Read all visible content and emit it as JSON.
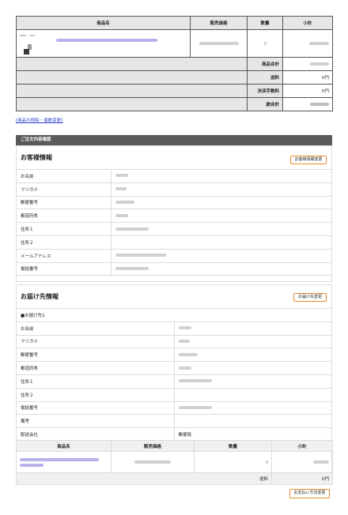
{
  "cart": {
    "headers": [
      "商品名",
      "販売価格",
      "数量",
      "小計"
    ],
    "summary": [
      {
        "label": "商品合計",
        "value": ""
      },
      {
        "label": "送料",
        "value": "0円"
      },
      {
        "label": "決済手数料",
        "value": "0円"
      },
      {
        "label": "総合計",
        "value": ""
      }
    ]
  },
  "edit_link": "[商品の削除・個数変更]",
  "confirm_bar": "ご注文内容確認",
  "customer": {
    "title": "お客様情報",
    "button": "お客様情報変更",
    "rows": [
      {
        "label": "お名前"
      },
      {
        "label": "フリガナ"
      },
      {
        "label": "郵便番号"
      },
      {
        "label": "都道府県"
      },
      {
        "label": "住所１"
      },
      {
        "label": "住所２"
      },
      {
        "label": "メールアドレス"
      },
      {
        "label": "電話番号"
      }
    ]
  },
  "delivery": {
    "title": "お届け先情報",
    "button": "お届け先変更",
    "subheading": "■お届け先1",
    "rows": [
      {
        "label": "お名前",
        "value": ""
      },
      {
        "label": "フリガナ",
        "value": ""
      },
      {
        "label": "郵便番号",
        "value": ""
      },
      {
        "label": "都道府県",
        "value": ""
      },
      {
        "label": "住所１",
        "value": ""
      },
      {
        "label": "住所２",
        "value": ""
      },
      {
        "label": "電話番号",
        "value": ""
      },
      {
        "label": "備考",
        "value": ""
      },
      {
        "label": "配送会社",
        "value": "郵便局"
      }
    ],
    "item_headers": [
      "商品名",
      "販売価格",
      "数量",
      "小計"
    ],
    "shipping_label": "送料",
    "shipping_value": "0円"
  },
  "payment_button": "お支払い方法変更"
}
